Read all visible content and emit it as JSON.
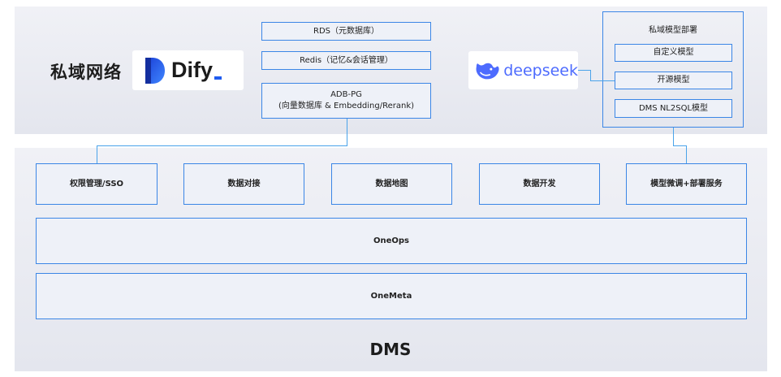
{
  "private_network": {
    "title": "私域网络",
    "dify_logo_text": "Dify",
    "deepseek_logo_text": "deepseek",
    "stores": [
      "RDS（元数据库）",
      "Redis（记忆&会话管理）"
    ],
    "adb": {
      "title": "ADB-PG",
      "subtitle": "(向量数据库 & Embedding/Rerank)"
    },
    "model_deploy": {
      "title": "私域模型部署",
      "items": [
        "自定义模型",
        "开源模型",
        "DMS NL2SQL模型"
      ]
    }
  },
  "dms": {
    "services": [
      "权限管理/SSO",
      "数据对接",
      "数据地图",
      "数据开发",
      "模型微调+部署服务"
    ],
    "oneops": "OneOps",
    "onemeta": "OneMeta",
    "title": "DMS"
  },
  "colors": {
    "border": "#3b86e6",
    "connector": "#4aa3ea",
    "dify_blue": "#1f5cf0",
    "deepseek_blue": "#4d6bfe"
  }
}
